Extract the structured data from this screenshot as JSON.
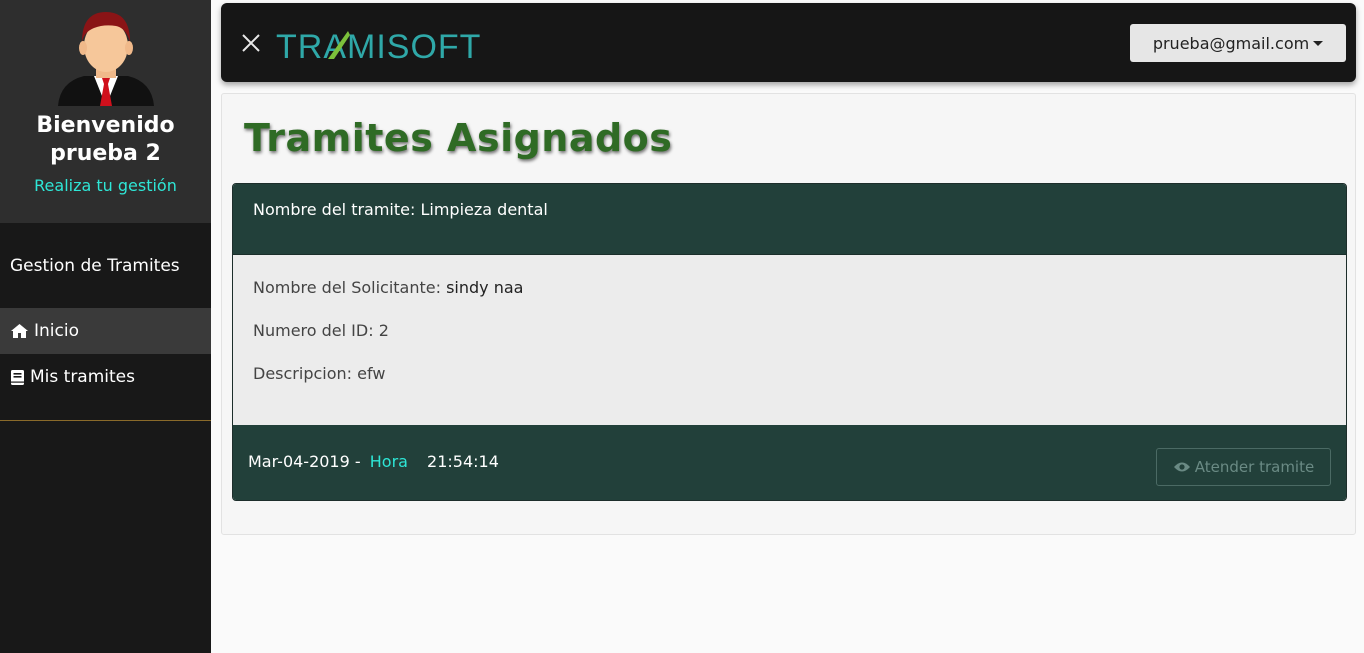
{
  "sidebar": {
    "welcome_line1": "Bienvenido",
    "welcome_line2": "prueba 2",
    "subtitle": "Realiza tu gestión",
    "section_title": "Gestion de Tramites",
    "items": [
      {
        "label": "Inicio",
        "icon": "home-icon",
        "active": true
      },
      {
        "label": "Mis tramites",
        "icon": "book-icon",
        "active": false
      }
    ]
  },
  "topbar": {
    "logo_text": "TRAMISOFT",
    "user_email": "prueba@gmail.com"
  },
  "main": {
    "page_title": "Tramites Asignados",
    "card": {
      "header_label": "Nombre del tramite:",
      "header_value": "Limpieza dental",
      "solicitante_label": "Nombre del Solicitante:",
      "solicitante_value": "sindy naa",
      "id_label": "Numero del ID:",
      "id_value": "2",
      "descripcion_label": "Descripcion:",
      "descripcion_value": "efw",
      "date": "Mar-04-2019 -",
      "hora_label": "Hora",
      "time": "21:54:14",
      "attend_button": "Atender tramite"
    }
  },
  "colors": {
    "sidebar_bg": "#181818",
    "profile_bg": "#2e2e2e",
    "accent_teal": "#2ee6d6",
    "card_dark": "#22403a",
    "title_green": "#2f6b25"
  }
}
